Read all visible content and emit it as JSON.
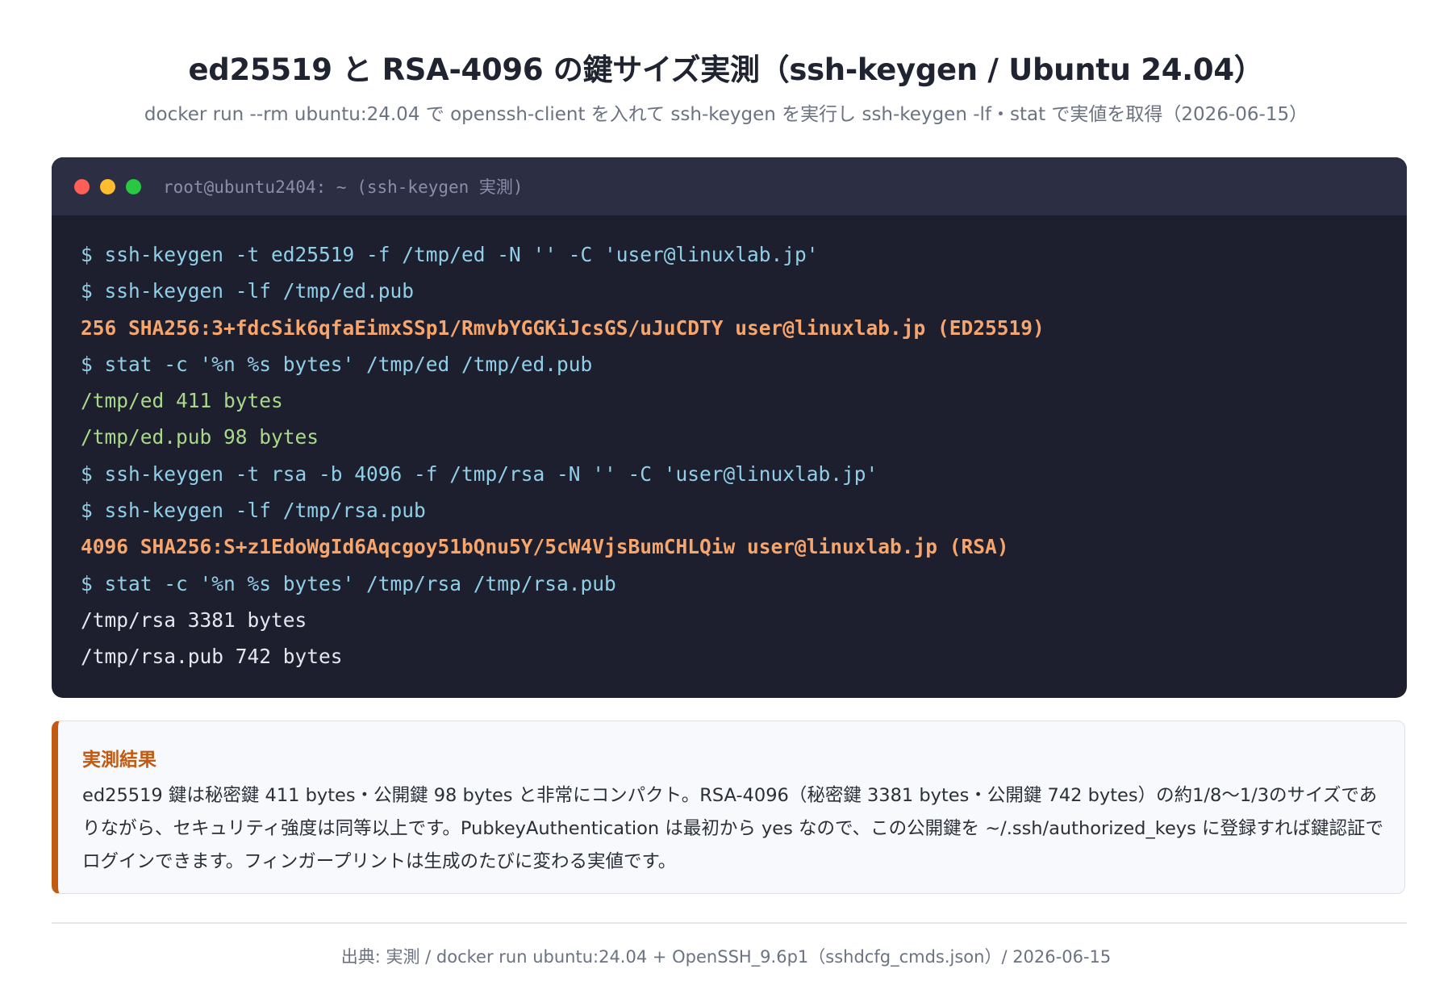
{
  "header": {
    "title": "ed25519 と RSA-4096 の鍵サイズ実測（ssh-keygen / Ubuntu 24.04）",
    "subtitle": "docker run --rm ubuntu:24.04 で openssh-client を入れて ssh-keygen を実行し ssh-keygen -lf・stat で実値を取得（2026-06-15）"
  },
  "terminal": {
    "window_title": "root@ubuntu2404: ~ (ssh-keygen 実測)",
    "lines": [
      "$ ssh-keygen -t ed25519 -f /tmp/ed -N '' -C 'user@linuxlab.jp'",
      "$ ssh-keygen -lf /tmp/ed.pub",
      "256 SHA256:3+fdcSik6qfaEimxSSp1/RmvbYGGKiJcsGS/uJuCDTY user@linuxlab.jp (ED25519)",
      "$ stat -c '%n %s bytes' /tmp/ed /tmp/ed.pub",
      "/tmp/ed 411 bytes",
      "/tmp/ed.pub 98 bytes",
      "$ ssh-keygen -t rsa -b 4096 -f /tmp/rsa -N '' -C 'user@linuxlab.jp'",
      "$ ssh-keygen -lf /tmp/rsa.pub",
      "4096 SHA256:S+z1EdoWgId6Aqcgoy51bQnu5Y/5cW4VjsBumCHLQiw user@linuxlab.jp (RSA)",
      "$ stat -c '%n %s bytes' /tmp/rsa /tmp/rsa.pub",
      "/tmp/rsa 3381 bytes",
      "/tmp/rsa.pub 742 bytes"
    ],
    "colors": {
      "command": "#8fd0e8",
      "fingerprint": "#f6a56c",
      "ed_output": "#a8d98a",
      "rsa_output": "#e5e7ef"
    }
  },
  "result": {
    "label": "実測結果",
    "text": "ed25519 鍵は秘密鍵 411 bytes・公開鍵 98 bytes と非常にコンパクト。RSA-4096（秘密鍵 3381 bytes・公開鍵 742 bytes）の約1/8〜1/3のサイズでありながら、セキュリティ強度は同等以上です。PubkeyAuthentication は最初から yes なので、この公開鍵を ~/.ssh/authorized_keys に登録すれば鍵認証でログインできます。フィンガープリントは生成のたびに変わる実値です。"
  },
  "footer": {
    "source": "出典: 実測 / docker run ubuntu:24.04 + OpenSSH_9.6p1（sshdcfg_cmds.json）/ 2026-06-15"
  }
}
